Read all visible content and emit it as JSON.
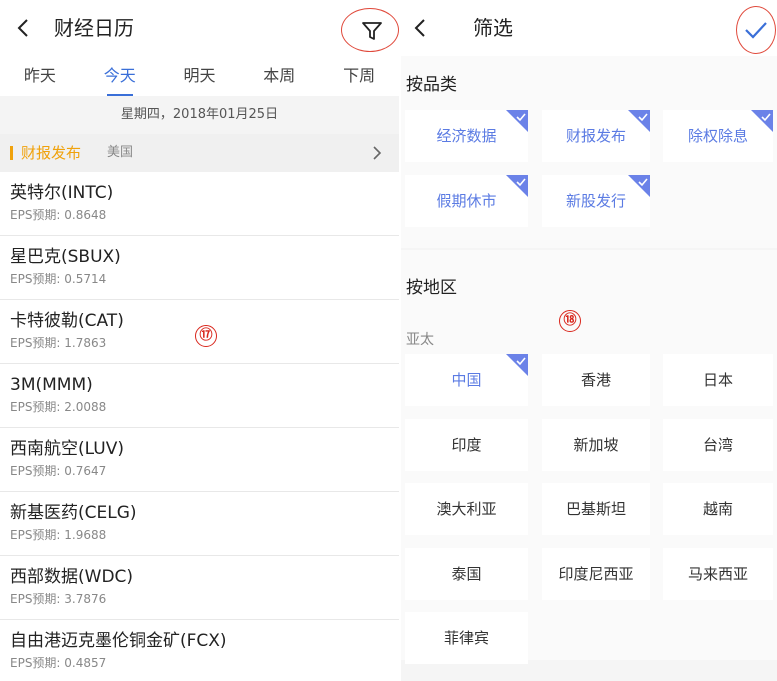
{
  "left": {
    "title": "财经日历",
    "back_icon": "chevron-left-icon",
    "filter_icon": "filter-icon",
    "tabs": [
      {
        "label": "昨天",
        "active": false
      },
      {
        "label": "今天",
        "active": true
      },
      {
        "label": "明天",
        "active": false
      },
      {
        "label": "本周",
        "active": false
      },
      {
        "label": "下周",
        "active": false
      }
    ],
    "date": "星期四，2018年01月25日",
    "section": {
      "title": "财报发布",
      "subtitle": "美国"
    },
    "items": [
      {
        "name": "英特尔(INTC)",
        "eps": "EPS预期: 0.8648"
      },
      {
        "name": "星巴克(SBUX)",
        "eps": "EPS预期: 0.5714"
      },
      {
        "name": "卡特彼勒(CAT)",
        "eps": "EPS预期: 1.7863"
      },
      {
        "name": "3M(MMM)",
        "eps": "EPS预期: 2.0088"
      },
      {
        "name": "西南航空(LUV)",
        "eps": "EPS预期: 0.7647"
      },
      {
        "name": "新基医药(CELG)",
        "eps": "EPS预期: 1.9688"
      },
      {
        "name": "西部数据(WDC)",
        "eps": "EPS预期: 3.7876"
      },
      {
        "name": "自由港迈克墨伦铜金矿(FCX)",
        "eps": "EPS预期: 0.4857"
      }
    ],
    "badge": "⑰"
  },
  "right": {
    "title": "筛选",
    "back_icon": "chevron-left-icon",
    "confirm_icon": "checkmark-icon",
    "category_title": "按品类",
    "categories": [
      {
        "label": "经济数据",
        "selected": true
      },
      {
        "label": "财报发布",
        "selected": true
      },
      {
        "label": "除权除息",
        "selected": true
      },
      {
        "label": "假期休市",
        "selected": true
      },
      {
        "label": "新股发行",
        "selected": true
      }
    ],
    "region_title": "按地区",
    "region_sub": "亚太",
    "regions": [
      {
        "label": "中国",
        "selected": true
      },
      {
        "label": "香港",
        "selected": false
      },
      {
        "label": "日本",
        "selected": false
      },
      {
        "label": "印度",
        "selected": false
      },
      {
        "label": "新加坡",
        "selected": false
      },
      {
        "label": "台湾",
        "selected": false
      },
      {
        "label": "澳大利亚",
        "selected": false
      },
      {
        "label": "巴基斯坦",
        "selected": false
      },
      {
        "label": "越南",
        "selected": false
      },
      {
        "label": "泰国",
        "selected": false
      },
      {
        "label": "印度尼西亚",
        "selected": false
      },
      {
        "label": "马来西亚",
        "selected": false
      },
      {
        "label": "菲律宾",
        "selected": false
      }
    ],
    "badge": "⑱"
  },
  "colors": {
    "accent_blue": "#3a6fd8",
    "chip_selected": "#5b7be3",
    "section_orange": "#f0a20c",
    "annotation_red": "#e04a3c"
  }
}
